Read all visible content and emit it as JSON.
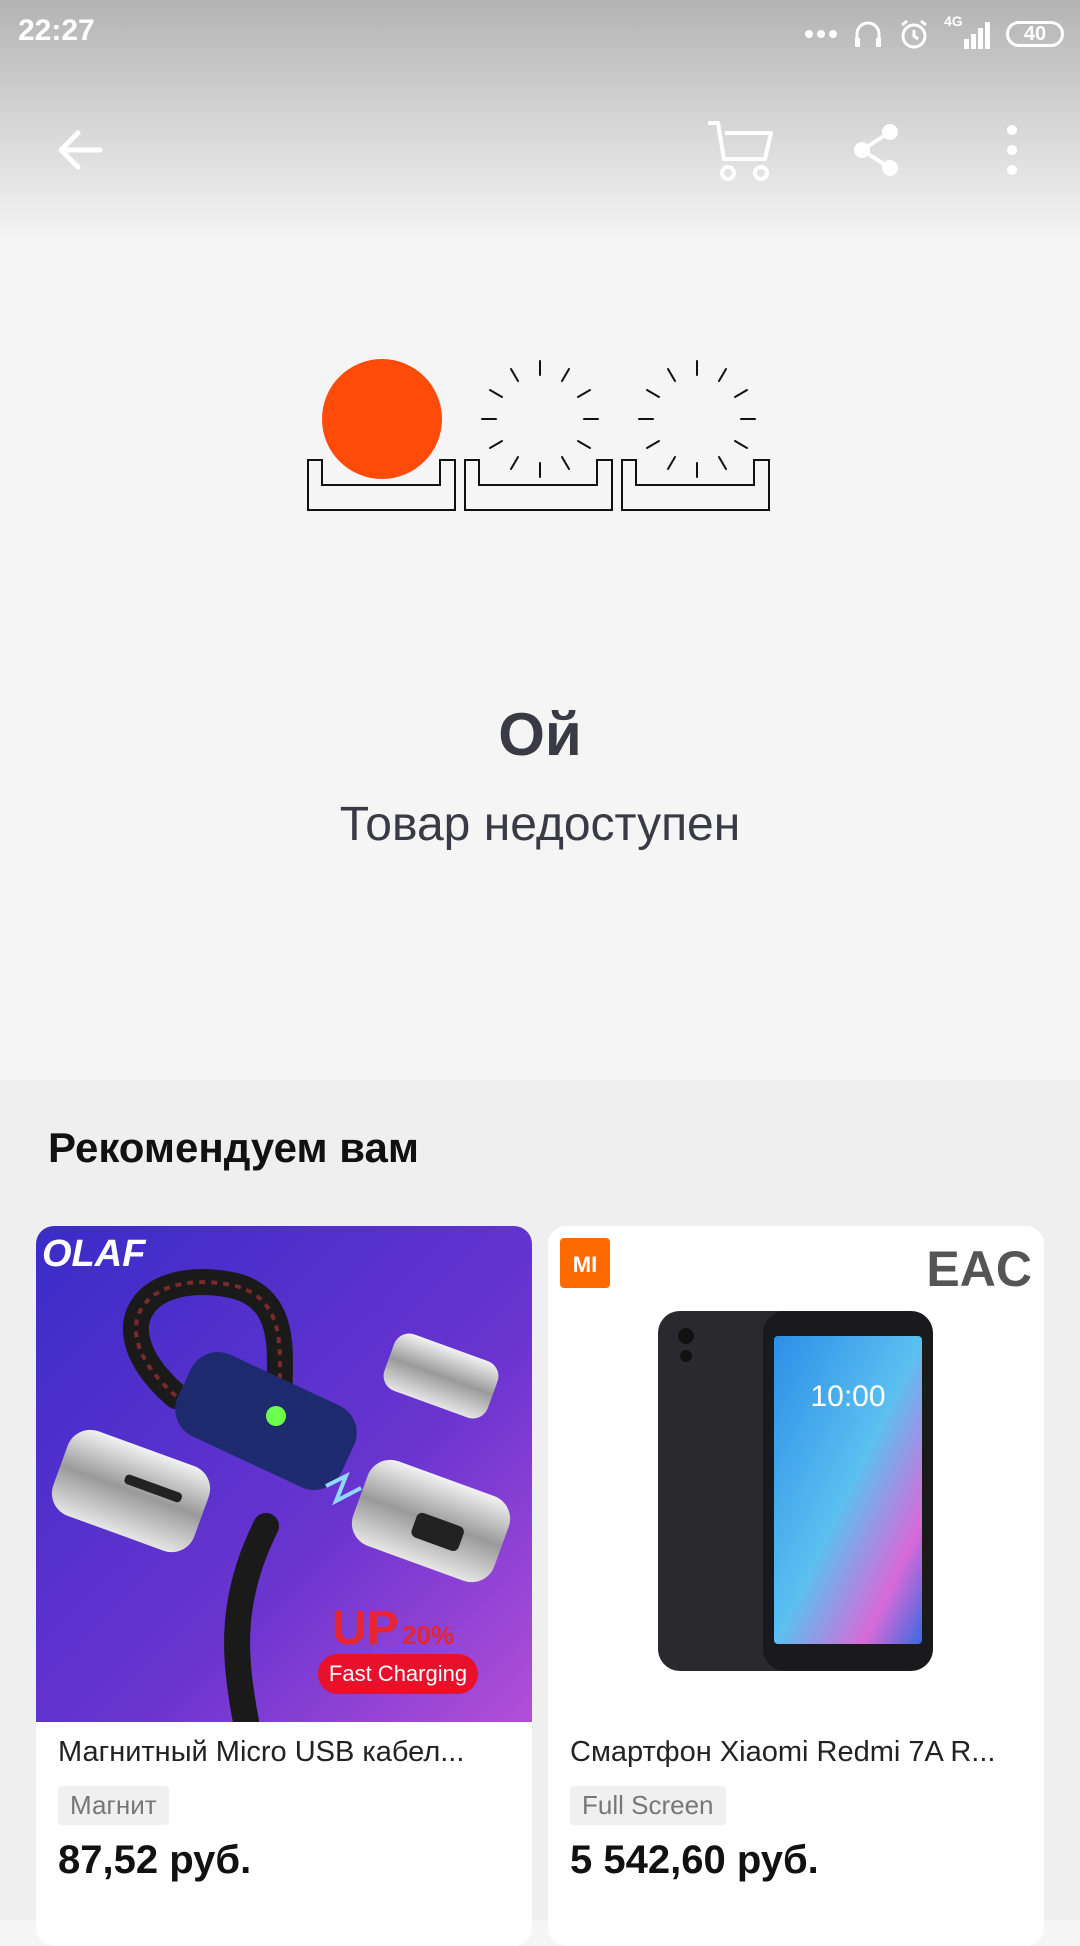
{
  "status_bar": {
    "time": "22:27",
    "network": "4G",
    "battery": "40"
  },
  "app_bar": {
    "back_icon": "arrow-left-icon",
    "cart_icon": "cart-icon",
    "share_icon": "share-icon",
    "more_icon": "more-vertical-icon"
  },
  "error": {
    "title": "Ой",
    "message": "Товар недоступен"
  },
  "recommendations": {
    "heading": "Рекомендуем вам",
    "items": [
      {
        "brand_logo": "OLAF",
        "image_badge_main": "UP",
        "image_badge_pct": "20%",
        "image_badge_sub": "Fast Charging",
        "title": "Магнитный Micro USB кабел...",
        "tag": "Магнит",
        "price": "87,52 руб."
      },
      {
        "brand_logo": "MI",
        "cert_logo": "EAC",
        "phone_time": "10:00",
        "title": "Смартфон Xiaomi Redmi 7A R...",
        "tag": "Full Screen",
        "price": "5 542,60 руб."
      }
    ]
  },
  "colors": {
    "accent": "#ff4b0a",
    "text_dark": "#3a3a44"
  }
}
